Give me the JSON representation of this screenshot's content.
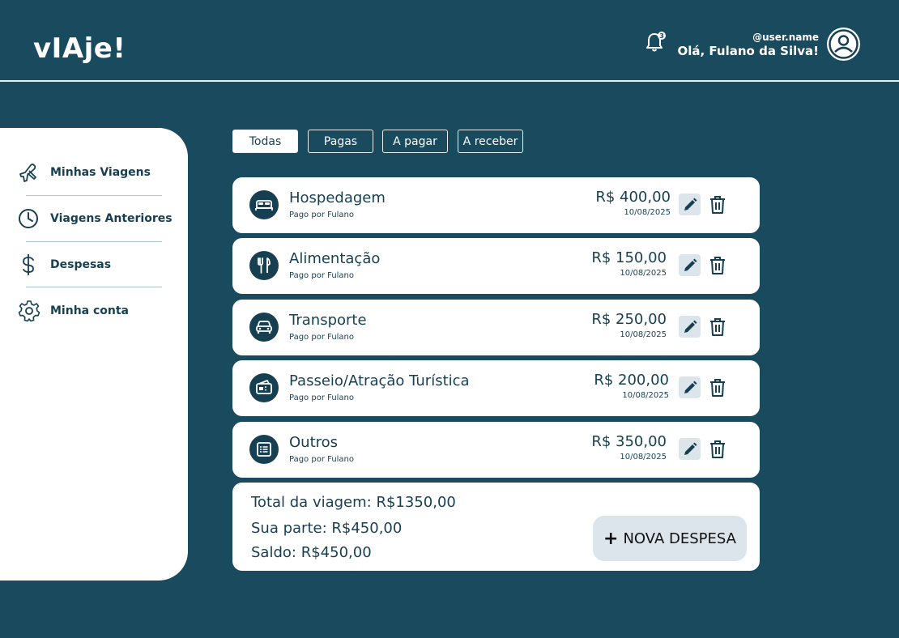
{
  "app": {
    "logo": "vIAje!"
  },
  "header": {
    "notification_count": "3",
    "user_handle": "@user.name",
    "greeting": "Olá, Fulano da Silva!"
  },
  "sidebar": {
    "items": [
      {
        "label": "Minhas Viagens",
        "icon": "plane-icon"
      },
      {
        "label": "Viagens Anteriores",
        "icon": "clock-icon"
      },
      {
        "label": "Despesas",
        "icon": "dollar-icon"
      },
      {
        "label": "Minha conta",
        "icon": "gear-icon"
      }
    ]
  },
  "filters": {
    "tabs": [
      "Todas",
      "Pagas",
      "A pagar",
      "A receber"
    ],
    "active": "Todas"
  },
  "expenses": [
    {
      "category": "Hospedagem",
      "paid_by": "Pago por Fulano",
      "amount": "R$ 400,00",
      "date": "10/08/2025",
      "icon": "bed-icon"
    },
    {
      "category": "Alimentação",
      "paid_by": "Pago por Fulano",
      "amount": "R$ 150,00",
      "date": "10/08/2025",
      "icon": "cutlery-icon"
    },
    {
      "category": "Transporte",
      "paid_by": "Pago por Fulano",
      "amount": "R$ 250,00",
      "date": "10/08/2025",
      "icon": "car-icon"
    },
    {
      "category": "Passeio/Atração Turística",
      "paid_by": "Pago por Fulano",
      "amount": "R$ 200,00",
      "date": "10/08/2025",
      "icon": "ticket-icon"
    },
    {
      "category": "Outros",
      "paid_by": "Pago por Fulano",
      "amount": "R$ 350,00",
      "date": "10/08/2025",
      "icon": "list-icon"
    }
  ],
  "summary": {
    "total_label": "Total da viagem:",
    "total_value": "R$1350,00",
    "share_label": "Sua parte:",
    "share_value": "R$450,00",
    "balance_label": "Saldo:",
    "balance_value": "R$450,00",
    "new_button": "NOVA DESPESA"
  },
  "colors": {
    "background": "#1a4a5e",
    "primary_dark": "#173f52",
    "button_light": "#dbe5eb"
  }
}
